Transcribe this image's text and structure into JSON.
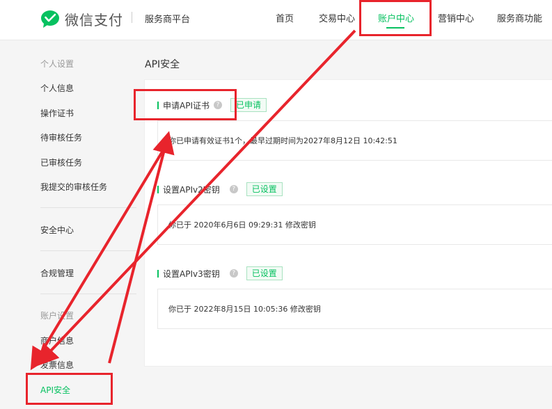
{
  "header": {
    "brand": "微信支付",
    "platform": "服务商平台",
    "nav": [
      "首页",
      "交易中心",
      "账户中心",
      "营销中心",
      "服务商功能"
    ],
    "active_nav": "账户中心"
  },
  "sidebar": {
    "group_personal": "个人设置",
    "personal_items": [
      "个人信息",
      "操作证书",
      "待审核任务",
      "已审核任务",
      "我提交的审核任务"
    ],
    "security_center": "安全中心",
    "compliance": "合规管理",
    "group_account": "账户设置",
    "account_items": [
      "商户信息",
      "发票信息",
      "API安全"
    ]
  },
  "main": {
    "title": "API安全",
    "sections": [
      {
        "title": "申请API证书",
        "help": "?",
        "status": "已申请",
        "detail": "你已申请有效证书1个，最早过期时间为2027年8月12日 10:42:51"
      },
      {
        "title": "设置APIv2密钥",
        "help": "?",
        "status": "已设置",
        "detail": "你已于 2020年6月6日 09:29:31 修改密钥"
      },
      {
        "title": "设置APIv3密钥",
        "help": "?",
        "status": "已设置",
        "detail": "你已于 2022年8月15日 10:05:36 修改密钥"
      }
    ]
  },
  "colors": {
    "accent": "#07c160",
    "annotation": "#e8242c"
  }
}
